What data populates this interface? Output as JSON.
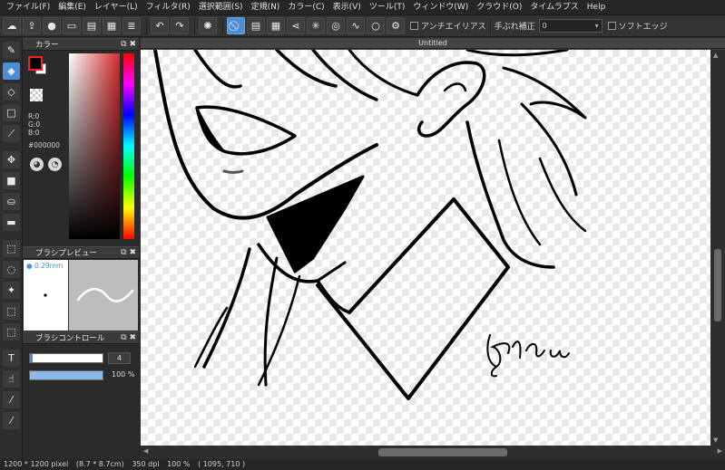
{
  "menu": [
    "ファイル(F)",
    "編集(E)",
    "レイヤー(L)",
    "フィルタ(R)",
    "選択範囲(S)",
    "定規(N)",
    "カラー(C)",
    "表示(V)",
    "ツール(T)",
    "ウィンドウ(W)",
    "クラウド(O)",
    "タイムラプス",
    "Help"
  ],
  "toolbar": {
    "antialias_label": "アンチエイリアス",
    "stabilizer_label": "手ぶれ補正",
    "stabilizer_value": "0",
    "soft_edge_label": "ソフトエッジ"
  },
  "panels": {
    "color_title": "カラー",
    "color_rgb": [
      "R:0",
      "G:0",
      "B:0"
    ],
    "color_hex": "#000000",
    "brush_preview_title": "ブラシプレビュー",
    "brush_size": "0.29mm",
    "brush_control_title": "ブラシコントロール",
    "brush_width_value": "4",
    "brush_width_fraction": 0.04,
    "brush_opacity_value": "100 %",
    "brush_opacity_fraction": 1.0
  },
  "document": {
    "tab_title": "Untitled"
  },
  "signature_text": "Rira",
  "status": {
    "canvas_size": "1200 * 1200 pixel",
    "physical_size": "(8.7 * 8.7cm)",
    "dpi": "350 dpi",
    "zoom": "100 %",
    "cursor": "( 1095, 710 )"
  },
  "colors": {
    "accent": "#4a8ed8",
    "foreground": "#000000",
    "background": "#ffffff"
  }
}
